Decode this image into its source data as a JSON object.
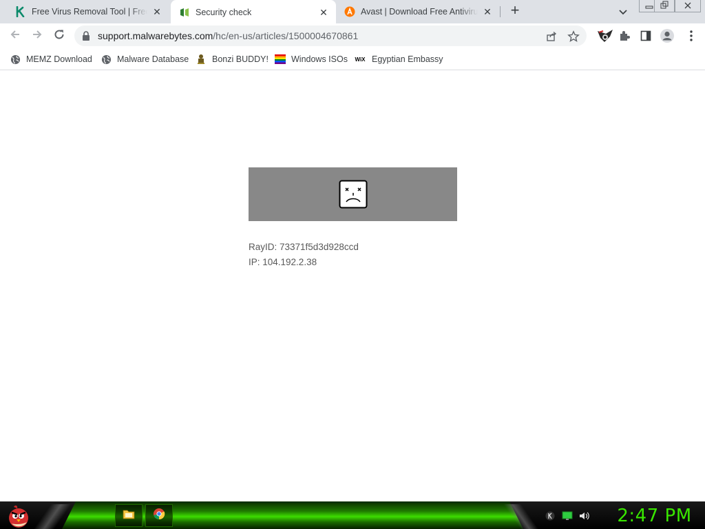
{
  "browser": {
    "tabs": [
      {
        "title": "Free Virus Removal Tool | Free Vi",
        "active": false,
        "favicon": "kaspersky-k-icon"
      },
      {
        "title": "Security check",
        "active": true,
        "favicon": "green-shield-icon"
      },
      {
        "title": "Avast | Download Free Antivirus &",
        "active": false,
        "favicon": "avast-icon"
      }
    ],
    "close_glyph": "✕",
    "new_tab_glyph": "+",
    "address": {
      "host": "support.malwarebytes.com",
      "path": "/hc/en-us/articles/1500004670861"
    },
    "bookmarks": [
      {
        "label": "MEMZ Download",
        "icon": "globe-icon"
      },
      {
        "label": "Malware Database",
        "icon": "globe-icon"
      },
      {
        "label": "Bonzi BUDDY!",
        "icon": "bonzi-icon"
      },
      {
        "label": "Windows ISOs",
        "icon": "rainbow-flag-icon"
      },
      {
        "label": "Egyptian Embassy",
        "icon": "wix-icon"
      }
    ],
    "wix_text": "WiX"
  },
  "page": {
    "ray_id": "RayID: 73371f5d3d928ccd",
    "ip": "IP: 104.192.2.38"
  },
  "taskbar": {
    "clock": "2:47 PM"
  },
  "colors": {
    "accent_green": "#39e600",
    "error_box": "#888888"
  }
}
